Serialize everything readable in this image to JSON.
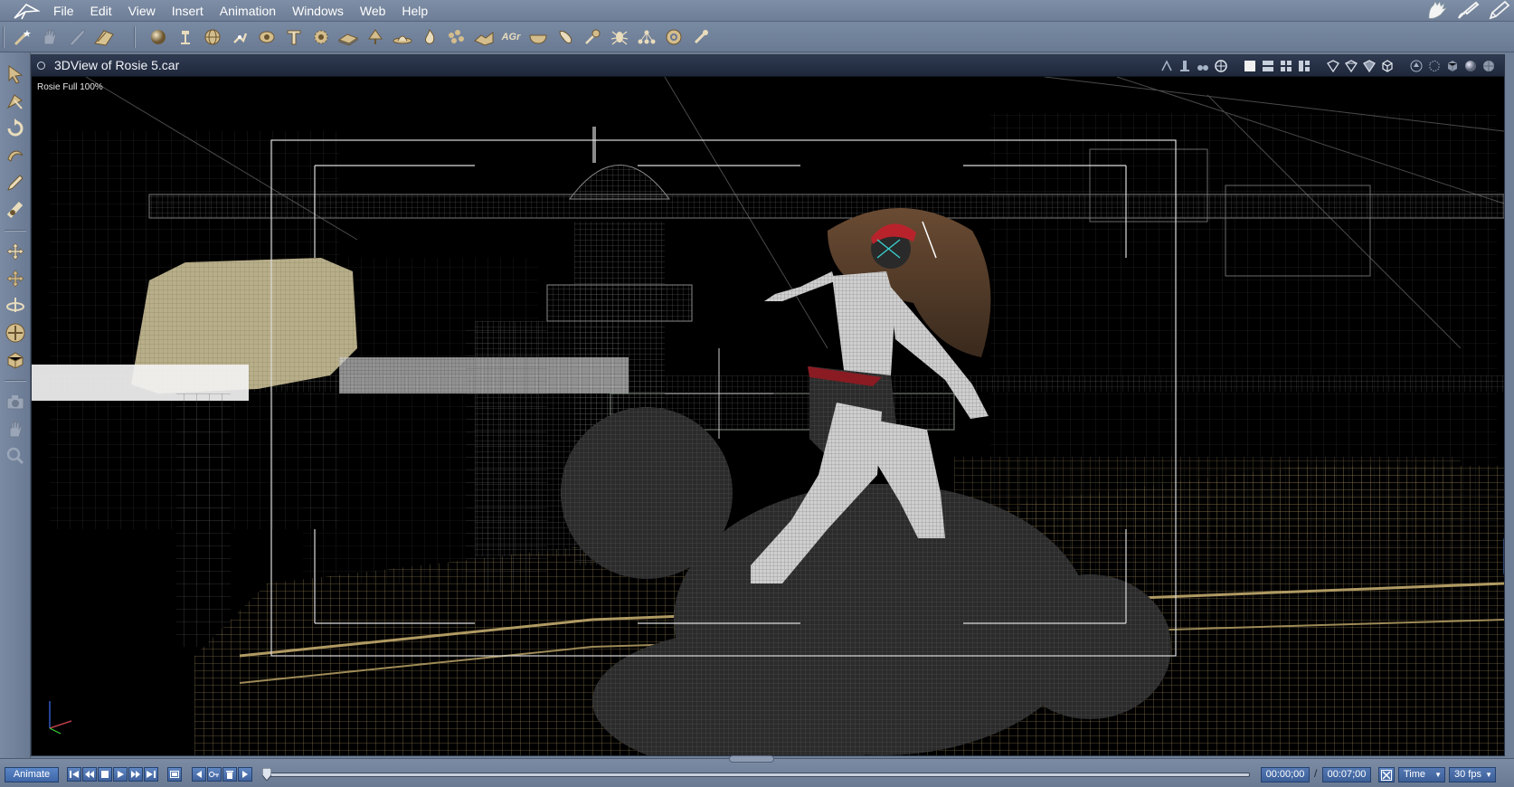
{
  "menubar": {
    "items": [
      "File",
      "Edit",
      "View",
      "Insert",
      "Animation",
      "Windows",
      "Web",
      "Help"
    ],
    "right_icons": [
      "hand-glove-icon",
      "paint-brush-icon",
      "pen-edit-icon"
    ]
  },
  "toolbar": {
    "group1": [
      "magic-wand-icon",
      "hand-icon",
      "pointer-hand-icon",
      "render-icon"
    ],
    "group2": [
      "sphere-icon",
      "light-icon",
      "globe-icon",
      "skeleton-icon",
      "eye-target-icon",
      "text-icon",
      "gear-cog-icon",
      "plane-icon",
      "tree-icon",
      "hat-icon",
      "fire-icon",
      "particles-icon",
      "terrain-icon",
      "agr-icon",
      "bowl-icon",
      "bone-icon",
      "pin-icon",
      "insect-icon",
      "network-icon",
      "target-icon",
      "brush-tool-icon"
    ],
    "agr_label": "AGr"
  },
  "left_palette": [
    "select-arrow-icon",
    "direct-select-icon",
    "rotate-icon",
    "twist-icon",
    "pencil-icon",
    "tape-icon",
    "move-icon",
    "move-xy-icon",
    "rotate-3d-icon",
    "scale-icon",
    "box-icon",
    "camera-icon",
    "hand-pan-icon",
    "zoom-icon"
  ],
  "viewport": {
    "title": "3DView of Rosie 5.car",
    "camera_label": "Rosie Full 100%",
    "right_icons": [
      "dolly-icon",
      "crane-icon",
      "track-icon",
      "shell-icon",
      "layout-single-icon",
      "layout-two-icon",
      "layout-four-icon",
      "layout-split-icon",
      "shield-a-icon",
      "shield-b-icon",
      "shield-c-icon",
      "cube-wire-icon",
      "arrow-up-icon",
      "cube-dotted-icon",
      "cube-solid-icon",
      "sphere-shaded-icon",
      "sphere-textured-icon"
    ]
  },
  "timeline": {
    "animate_label": "Animate",
    "transport": [
      "go-start-icon",
      "prev-key-icon",
      "stop-icon",
      "play-icon",
      "next-key-icon",
      "go-end-icon"
    ],
    "frame_icon": "frame-icon",
    "key_tools": [
      "prev-icon",
      "key-icon",
      "trash-icon",
      "next-icon"
    ],
    "current_time": "00:00;00",
    "separator": "/",
    "total_time": "00:07;00",
    "fit_icon": "fit-x-icon",
    "mode": "Time",
    "fps": "30 fps",
    "progress": 0
  },
  "colors": {
    "menubar": "#7888a0",
    "viewport_title": "#2a344a",
    "scene_bg": "#000000",
    "wire_gray": "#7a7a7a",
    "wire_gold": "#7d6a44",
    "bandana_red": "#b8232b",
    "accent_blue": "#4a72b0"
  }
}
